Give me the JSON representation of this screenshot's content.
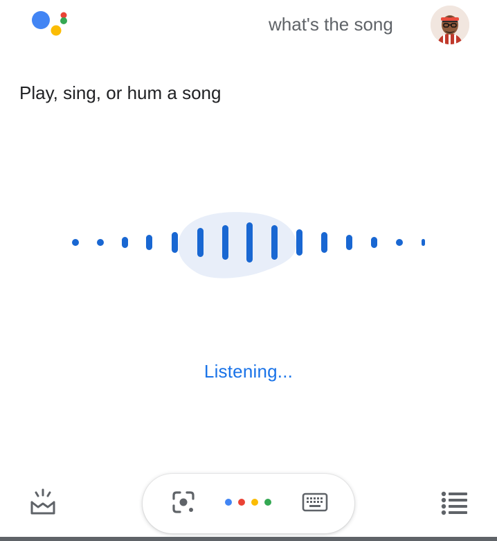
{
  "header": {
    "logo_icon": "google-assistant-logo-icon",
    "query_text": "what's the song",
    "avatar_icon": "user-avatar-icon"
  },
  "main": {
    "prompt": "Play, sing, or hum a song",
    "status": "Listening..."
  },
  "colors": {
    "blue": "#1a73e8",
    "red": "#ea4335",
    "yellow": "#fbbc04",
    "green": "#34a853",
    "wave_highlight": "#e8eef9",
    "icon_gray": "#5f6368"
  },
  "bottom_bar": {
    "updates_icon": "updates-inbox-icon",
    "lens_icon": "google-lens-icon",
    "assistant_dots_icon": "assistant-dots-icon",
    "keyboard_icon": "keyboard-icon",
    "menu_icon": "list-menu-icon"
  }
}
